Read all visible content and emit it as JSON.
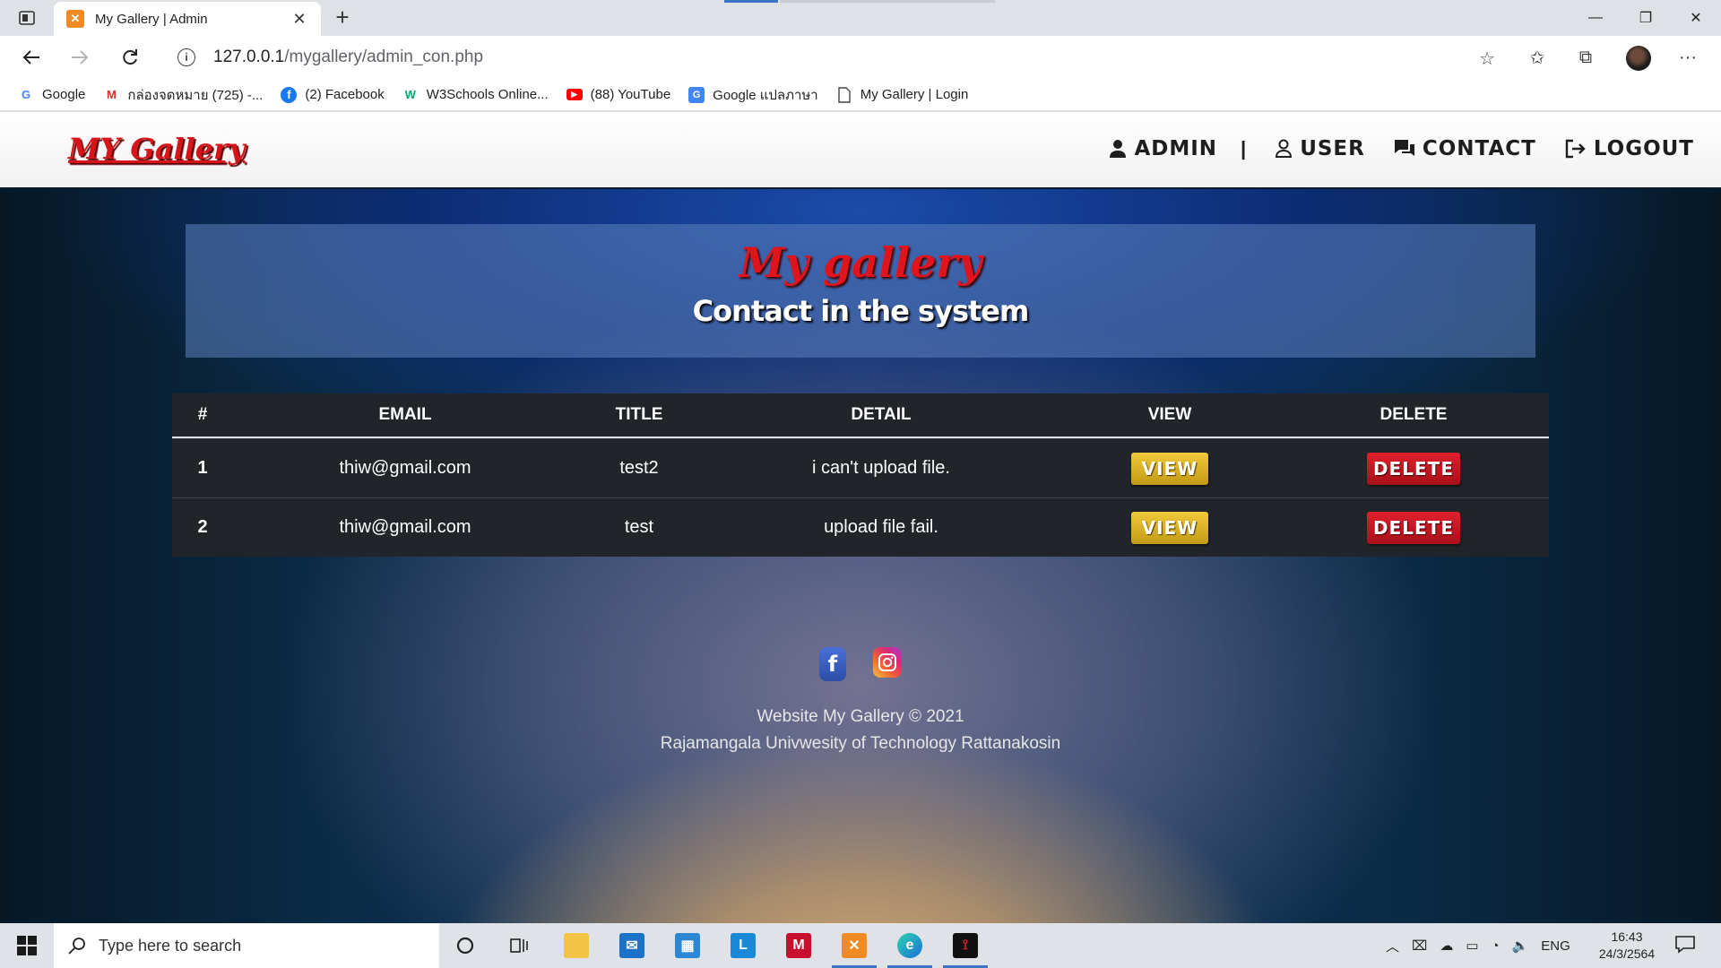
{
  "browser": {
    "tab_title": "My Gallery | Admin",
    "url_host": "127.0.0.1",
    "url_path": "/mygallery/admin_con.php",
    "bookmarks": [
      {
        "label": "Google",
        "icon": "google-icon",
        "color": "#4285f4"
      },
      {
        "label": "กล่องจดหมาย (725) -...",
        "icon": "gmail-icon",
        "color": "#d93025"
      },
      {
        "label": "(2) Facebook",
        "icon": "facebook-icon",
        "color": "#1877f2"
      },
      {
        "label": "W3Schools Online...",
        "icon": "w3schools-icon",
        "color": "#04aa6d"
      },
      {
        "label": "(88) YouTube",
        "icon": "youtube-icon",
        "color": "#ff0000"
      },
      {
        "label": "Google แปลภาษา",
        "icon": "google-translate-icon",
        "color": "#4285f4"
      },
      {
        "label": "My Gallery | Login",
        "icon": "page-icon",
        "color": "#555555"
      }
    ]
  },
  "site": {
    "brand": "MY Gallery",
    "nav": {
      "admin": "ADMIN",
      "separator": "|",
      "user": "USER",
      "contact": "CONTACT",
      "logout": "LOGOUT"
    },
    "hero_title": "My gallery",
    "hero_subtitle": "Contact in the system"
  },
  "table": {
    "headers": {
      "num": "#",
      "email": "EMAIL",
      "title": "TITLE",
      "detail": "DETAIL",
      "view": "VIEW",
      "delete": "DELETE"
    },
    "rows": [
      {
        "num": "1",
        "email": "thiw@gmail.com",
        "title": "test2",
        "detail": "i can't upload file.",
        "view_label": "VIEW",
        "delete_label": "DELETE"
      },
      {
        "num": "2",
        "email": "thiw@gmail.com",
        "title": "test",
        "detail": "upload file fail.",
        "view_label": "VIEW",
        "delete_label": "DELETE"
      }
    ]
  },
  "footer": {
    "line1": "Website My Gallery © 2021",
    "line2": "Rajamangala Univwesity of Technology Rattanakosin"
  },
  "taskbar": {
    "search_placeholder": "Type here to search",
    "language": "ENG",
    "time": "16:43",
    "date": "24/3/2564"
  },
  "colors": {
    "brand_red": "#d8141a",
    "table_bg": "#212529",
    "view_button": "#e0b52a",
    "delete_button": "#c8141e"
  }
}
